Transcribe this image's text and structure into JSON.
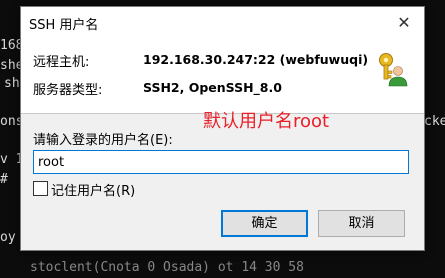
{
  "terminal": {
    "fragments": [
      {
        "id": "t1",
        "text": "168"
      },
      {
        "id": "t2",
        "text": "she"
      },
      {
        "id": "t3",
        "text": "sh"
      },
      {
        "id": "t4",
        "text": "ons"
      },
      {
        "id": "t5",
        "text": "cket"
      },
      {
        "id": "t6",
        "text": "v 1"
      },
      {
        "id": "t7",
        "text": "#"
      },
      {
        "id": "t8",
        "text": "oy"
      },
      {
        "id": "t9",
        "text": "stoclent(Cnota 0 Osada) ot 14 30 58"
      }
    ]
  },
  "dialog": {
    "title": "SSH 用户名",
    "close_glyph": "✕",
    "remote_host_label": "远程主机:",
    "remote_host_value": "192.168.30.247:22 (webfuwuqi)",
    "server_type_label": "服务器类型:",
    "server_type_value": "SSH2, OpenSSH_8.0",
    "annotation": "默认用户名root",
    "prompt": "请输入登录的用户名(E):",
    "username_value": "root",
    "remember_label": "记住用户名(R)",
    "remember_checked": false,
    "ok_label": "确定",
    "cancel_label": "取消",
    "icon": "key-user-icon"
  }
}
